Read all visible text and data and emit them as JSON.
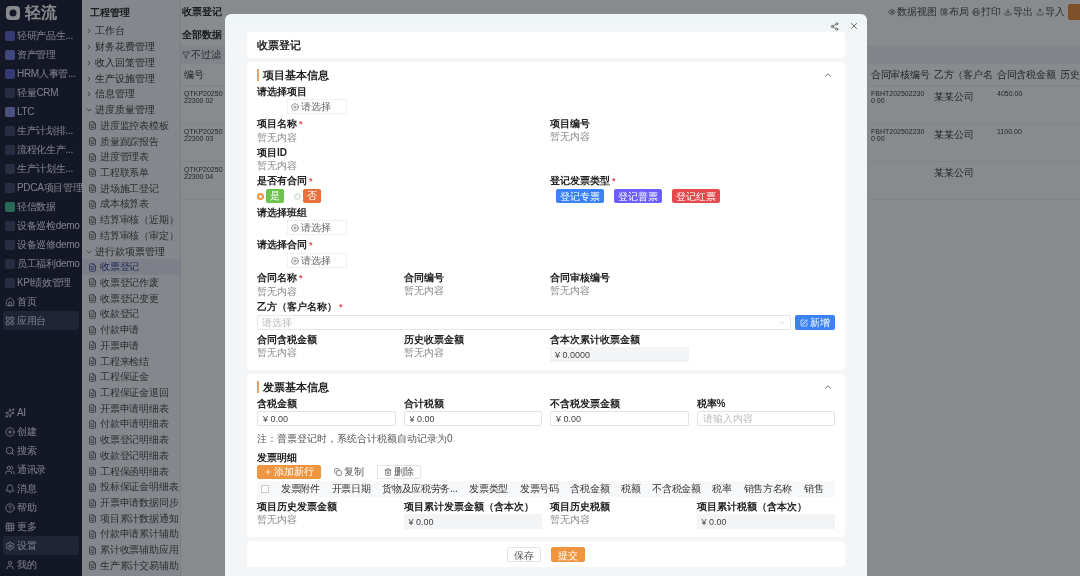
{
  "app_nav": {
    "logo": "轻流",
    "items": [
      {
        "label": "轻研产品生...",
        "selected": false
      },
      {
        "label": "资产管理",
        "selected": false
      },
      {
        "label": "HRM人事管...",
        "selected": false
      },
      {
        "label": "轻量CRM",
        "selected": false
      },
      {
        "label": "LTC",
        "selected": false
      },
      {
        "label": "生产计划排...",
        "selected": false
      },
      {
        "label": "流程化生产...",
        "selected": false
      },
      {
        "label": "生产计划生...",
        "selected": false
      },
      {
        "label": "PDCA项目管理",
        "selected": false
      },
      {
        "label": "轻信数据",
        "selected": false
      },
      {
        "label": "设备巡检demo",
        "selected": false
      },
      {
        "label": "设备巡修demo",
        "selected": false
      },
      {
        "label": "员工福利demo",
        "selected": false
      },
      {
        "label": "KPI绩效管理",
        "selected": false
      },
      {
        "label": "首页",
        "selected": false
      },
      {
        "label": "应用台",
        "selected": true
      }
    ],
    "bottom_items": [
      {
        "label": "AI",
        "selected": false
      },
      {
        "label": "创建",
        "selected": false
      },
      {
        "label": "搜索",
        "selected": false
      },
      {
        "label": "通讯录",
        "selected": false
      },
      {
        "label": "消息",
        "selected": false
      },
      {
        "label": "帮助",
        "selected": false
      },
      {
        "label": "更多",
        "selected": false
      },
      {
        "label": "设置",
        "selected": true
      },
      {
        "label": "我的",
        "selected": false
      }
    ]
  },
  "module_sidebar": {
    "title": "工程管理",
    "groups": [
      {
        "label": "工作台",
        "expanded": false
      },
      {
        "label": "财务花费管理",
        "expanded": false
      },
      {
        "label": "收入回笼管理",
        "expanded": false
      },
      {
        "label": "生产设施管理",
        "expanded": false
      },
      {
        "label": "信息管理",
        "expanded": false
      },
      {
        "label": "进度质量管理",
        "expanded": true,
        "children": [
          {
            "label": "进度监控表模板",
            "selected": false
          },
          {
            "label": "质量跟踪报告",
            "selected": false
          },
          {
            "label": "进度管理表",
            "selected": false
          },
          {
            "label": "工程联系单",
            "selected": false
          },
          {
            "label": "进场施工登记",
            "selected": false
          },
          {
            "label": "成本核算表",
            "selected": false
          },
          {
            "label": "结算审核（近期）",
            "selected": false
          },
          {
            "label": "结算审核（审定）",
            "selected": false
          }
        ]
      },
      {
        "label": "进行款项票管理",
        "expanded": true,
        "children": [
          {
            "label": "收票登记",
            "selected": true
          },
          {
            "label": "收票登记作废",
            "selected": false
          },
          {
            "label": "收票登记变更",
            "selected": false
          },
          {
            "label": "收款登记",
            "selected": false
          },
          {
            "label": "付款申请",
            "selected": false
          },
          {
            "label": "开票申请",
            "selected": false
          },
          {
            "label": "工程来检结",
            "selected": false
          },
          {
            "label": "工程保证金",
            "selected": false
          },
          {
            "label": "工程保证金退回",
            "selected": false
          },
          {
            "label": "开票申请明细表",
            "selected": false
          },
          {
            "label": "付款申请明细表",
            "selected": false
          },
          {
            "label": "收票登记明细表",
            "selected": false
          },
          {
            "label": "收款登记明细表",
            "selected": false
          },
          {
            "label": "工程保函明细表",
            "selected": false
          },
          {
            "label": "投标保证金明细表",
            "selected": false
          },
          {
            "label": "开票申请数据同步",
            "selected": false
          },
          {
            "label": "项目累计数据通知",
            "selected": false
          },
          {
            "label": "付款申请累计辅助",
            "selected": false
          },
          {
            "label": "累计收票辅助应用",
            "selected": false
          },
          {
            "label": "生产累计交易辅助",
            "selected": false
          }
        ]
      }
    ]
  },
  "main": {
    "tab": "收票登记",
    "view": "全部数据",
    "filter": "不过滤",
    "top_actions": [
      "数据视图",
      "布局",
      "打印",
      "导出",
      "导入"
    ],
    "table": {
      "first_column": "编号",
      "right_columns": [
        "合同审核编号",
        "乙方（客户名",
        "合同含税金额",
        "历史"
      ],
      "rows": [
        {
          "code": "QTKP2025022300 02",
          "cells": [
            "FBHT2025022300 00",
            "某某公司",
            "4050.00",
            ""
          ]
        },
        {
          "code": "QTKP2025022300 03",
          "cells": [
            "FBHT2025022300 00",
            "某某公司",
            "1100.00",
            ""
          ]
        },
        {
          "code": "QTKP2025022300 04",
          "cells": [
            "",
            "某某公司",
            "",
            ""
          ]
        }
      ]
    }
  },
  "modal": {
    "title": "收票登记",
    "sections": [
      {
        "title": "项目基本信息",
        "expanded": true,
        "rows": [
          [
            {
              "kind": "picker",
              "label": "请选择项目",
              "button": "请选择"
            }
          ],
          [
            {
              "kind": "text",
              "label": "项目名称",
              "required_mark": "*",
              "value": "暂无内容"
            },
            {
              "kind": "text",
              "label": "项目编号",
              "value": "暂无内容"
            }
          ],
          [
            {
              "kind": "text",
              "label": "项目ID",
              "value": "暂无内容"
            }
          ],
          [
            {
              "kind": "radio",
              "label": "是否有合同",
              "required_mark": "*",
              "options": [
                {
                  "label": "是",
                  "color": "#6cc24a",
                  "selected": true
                },
                {
                  "label": "否",
                  "color": "#e8703a",
                  "selected": false
                }
              ]
            },
            {
              "kind": "tags",
              "label": "登记发票类型",
              "required_mark": "*",
              "tags": [
                {
                  "label": "登记专票",
                  "color": "#3b82f6"
                },
                {
                  "label": "登记普票",
                  "color": "#6d5dfc"
                },
                {
                  "label": "登记红票",
                  "color": "#e5484d"
                }
              ]
            }
          ],
          [
            {
              "kind": "picker",
              "label": "请选择班组",
              "button": "请选择"
            }
          ],
          [
            {
              "kind": "picker",
              "label": "请选择合同",
              "required_mark": "*",
              "button": "请选择"
            }
          ],
          [
            {
              "kind": "text",
              "label": "合同名称",
              "required_mark": "*",
              "value": "暂无内容"
            },
            {
              "kind": "text",
              "label": "合同编号",
              "value": "暂无内容"
            },
            {
              "kind": "text",
              "label": "合同审核编号",
              "value": "暂无内容"
            }
          ],
          [
            {
              "kind": "select",
              "label": "乙方（客户名称）",
              "required_mark": "*",
              "placeholder": "请选择",
              "add_button": "新增"
            }
          ],
          [
            {
              "kind": "text",
              "label": "合同含税金额",
              "value": "暂无内容"
            },
            {
              "kind": "text",
              "label": "历史收票金额",
              "value": "暂无内容"
            },
            {
              "kind": "readonly",
              "label": "含本次累计收票金额",
              "value": "¥ 0.0000"
            }
          ]
        ]
      },
      {
        "title": "发票基本信息",
        "expanded": true,
        "rows": [
          [
            {
              "kind": "input",
              "label": "含税金额",
              "value": "¥ 0.00"
            },
            {
              "kind": "input",
              "label": "合计税额",
              "value": "¥ 0.00"
            },
            {
              "kind": "input",
              "label": "不含税发票金额",
              "value": "¥ 0.00"
            },
            {
              "kind": "input",
              "label": "税率%",
              "placeholder": "请输入内容"
            }
          ],
          [
            {
              "kind": "note",
              "text": "注：普票登记时，系统合计税额自动记录为0"
            }
          ],
          [
            {
              "kind": "table",
              "label": "发票明细",
              "buttons": [
                {
                  "label": "添加新行",
                  "kind": "primary"
                },
                {
                  "label": "复制",
                  "kind": "plain"
                },
                {
                  "label": "删除",
                  "kind": "outline"
                }
              ],
              "select_all_checked": false,
              "columns": [
                "发票附件",
                "开票日期",
                "货物及应税劳务...",
                "发票类型",
                "发票号码",
                "含税金额",
                "税额",
                "不含税金额",
                "税率",
                "销售方名称",
                "销售"
              ]
            }
          ],
          [
            {
              "kind": "text",
              "label": "项目历史发票金额",
              "value": "暂无内容"
            },
            {
              "kind": "readonly",
              "label": "项目累计发票金额（含本次）",
              "value": "¥ 0.00"
            },
            {
              "kind": "text",
              "label": "项目历史税额",
              "value": "暂无内容"
            },
            {
              "kind": "readonly",
              "label": "项目累计税额（含本次）",
              "value": "¥ 0.00"
            }
          ]
        ]
      }
    ],
    "footer_buttons": [
      {
        "label": "保存",
        "kind": "secondary"
      },
      {
        "label": "提交",
        "kind": "primary"
      }
    ]
  }
}
